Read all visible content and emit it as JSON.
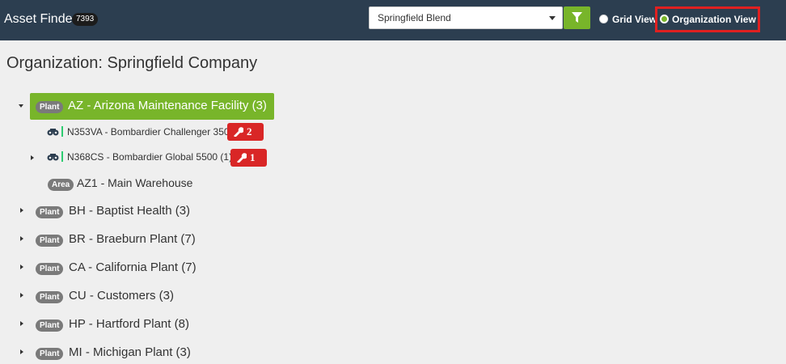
{
  "header": {
    "app_title": "Asset Finder",
    "asset_count": "7393",
    "organization_select": {
      "value": "Springfield Blend"
    },
    "view_options": [
      {
        "label": "Grid View",
        "selected": false
      },
      {
        "label": "Organization View",
        "selected": true
      }
    ]
  },
  "page": {
    "title": "Organization: Springfield Company"
  },
  "tree": {
    "selected_node": {
      "type": "Plant",
      "label": "AZ - Arizona Maintenance Facility (3)",
      "expanded": true
    },
    "children": [
      {
        "kind": "asset",
        "label": "N353VA - Bombardier Challenger 350",
        "work_orders": "2",
        "expandable": false
      },
      {
        "kind": "asset",
        "label": "N368CS - Bombardier Global 5500 (1)",
        "work_orders": "1",
        "expandable": true
      },
      {
        "kind": "area",
        "type": "Area",
        "label": "AZ1 - Main Warehouse"
      }
    ],
    "nodes": [
      {
        "type": "Plant",
        "label": "BH - Baptist Health (3)"
      },
      {
        "type": "Plant",
        "label": "BR - Braeburn Plant (7)"
      },
      {
        "type": "Plant",
        "label": "CA - California Plant (7)"
      },
      {
        "type": "Plant",
        "label": "CU - Customers (3)"
      },
      {
        "type": "Plant",
        "label": "HP - Hartford Plant (8)"
      },
      {
        "type": "Plant",
        "label": "MI - Michigan Plant (3)"
      }
    ]
  },
  "icons": {
    "filter": "filter-icon",
    "asset": "binoculars-icon",
    "work_order": "wrench-icon"
  },
  "colors": {
    "header_bg": "#2c3e50",
    "accent_green": "#78b52a",
    "work_order_red": "#d92626",
    "badge_gray": "#7a7a7a",
    "highlight_red": "#e02020"
  }
}
